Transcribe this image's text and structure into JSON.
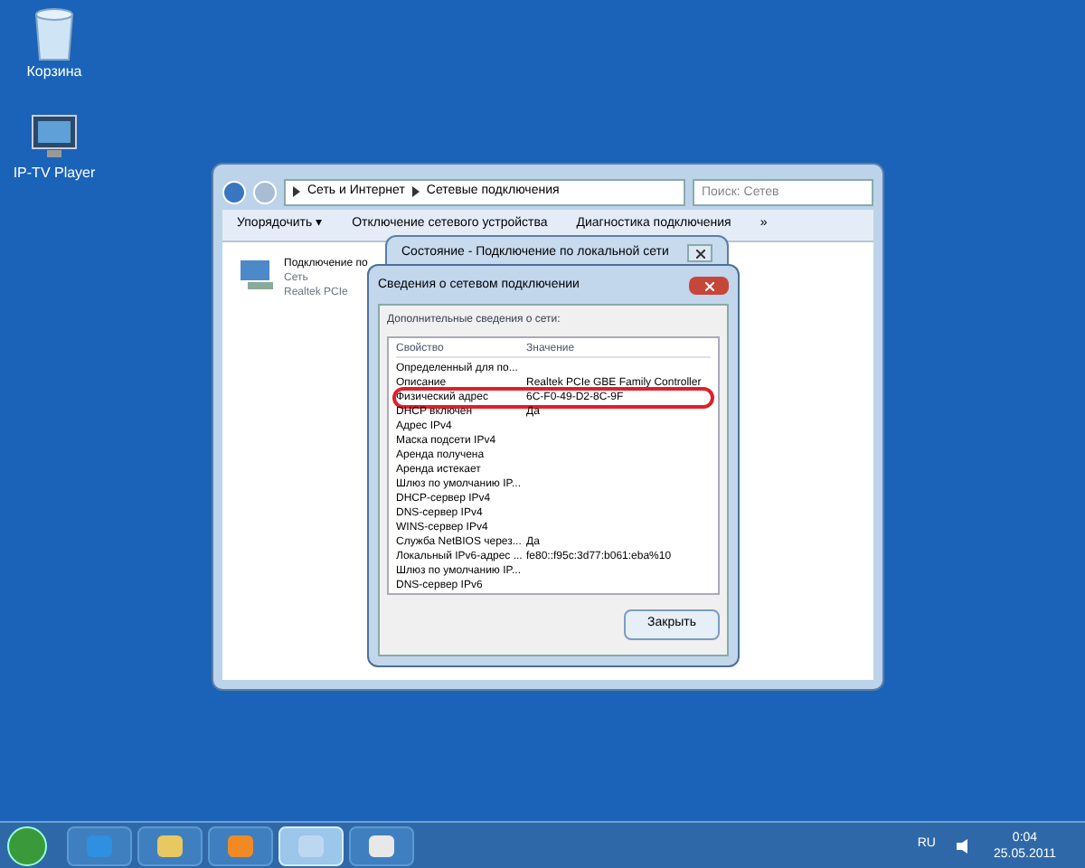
{
  "desktop_icons": [
    {
      "kind": "bin",
      "label": "Корзина"
    },
    {
      "kind": "player",
      "label": "IP-TV Player"
    }
  ],
  "explorer": {
    "breadcrumb": [
      "Сеть и Интернет",
      "Сетевые подключения"
    ],
    "search": {
      "placeholder": "Поиск: Сетев"
    },
    "toolbar": [
      "Упорядочить ▾",
      "Отключение сетевого устройства",
      "Диагностика подключения",
      "»"
    ],
    "connection": {
      "name": "Подключение по",
      "type": "Сеть",
      "adapter": "Realtek PCIe"
    }
  },
  "status_window": {
    "title": "Состояние - Подключение по локальной сети"
  },
  "details_dialog": {
    "title": "Сведения о сетевом подключении",
    "caption": "Дополнительные сведения о сети:",
    "columns": [
      "Свойство",
      "Значение"
    ],
    "rows": [
      {
        "property": "Определенный для по...",
        "value": "",
        "highlighted": false
      },
      {
        "property": "Описание",
        "value": "Realtek PCIe GBE Family Controller",
        "highlighted": false
      },
      {
        "property": "Физический адрес",
        "value": "6C-F0-49-D2-8C-9F",
        "highlighted": true
      },
      {
        "property": "DHCP включен",
        "value": "Да",
        "highlighted": false
      },
      {
        "property": "Адрес IPv4",
        "value": "",
        "highlighted": false
      },
      {
        "property": "Маска подсети IPv4",
        "value": "",
        "highlighted": false
      },
      {
        "property": "Аренда получена",
        "value": "",
        "highlighted": false
      },
      {
        "property": "Аренда истекает",
        "value": "",
        "highlighted": false
      },
      {
        "property": "Шлюз по умолчанию IP...",
        "value": "",
        "highlighted": false
      },
      {
        "property": "DHCP-сервер IPv4",
        "value": "",
        "highlighted": false
      },
      {
        "property": "DNS-сервер IPv4",
        "value": "",
        "highlighted": false
      },
      {
        "property": "WINS-сервер IPv4",
        "value": "",
        "highlighted": false
      },
      {
        "property": "Служба NetBIOS через...",
        "value": "Да",
        "highlighted": false
      },
      {
        "property": "Локальный IPv6-адрес ...",
        "value": "fe80::f95c:3d77:b061:eba%10",
        "highlighted": false
      },
      {
        "property": "Шлюз по умолчанию IP...",
        "value": "",
        "highlighted": false
      },
      {
        "property": "DNS-сервер IPv6",
        "value": "",
        "highlighted": false
      }
    ],
    "close_button": "Закрыть"
  },
  "taskbar": {
    "apps": [
      {
        "kind": "ie",
        "selected": false
      },
      {
        "kind": "folder",
        "selected": false
      },
      {
        "kind": "media",
        "selected": false
      },
      {
        "kind": "network",
        "selected": true
      },
      {
        "kind": "other",
        "selected": false
      }
    ],
    "language": "RU",
    "time": "0:04",
    "date": "25.05.2011"
  }
}
